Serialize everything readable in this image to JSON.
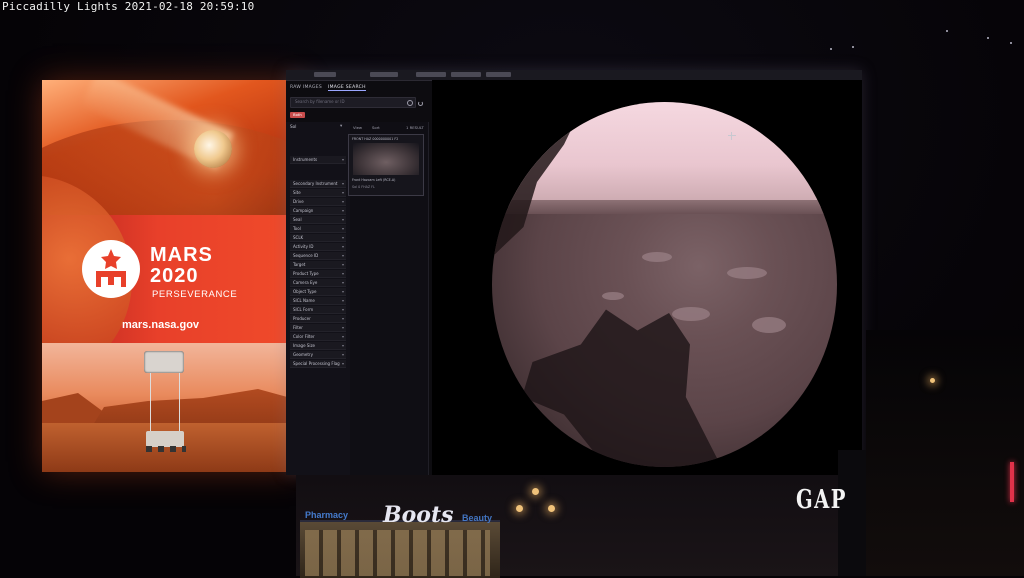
{
  "timestamp": "Piccadilly Lights 2021-02-18 20:59:10",
  "left_billboard": {
    "logo_line1": "MARS",
    "logo_line2": "2020",
    "logo_sub": "PERSEVERANCE",
    "url": "mars.nasa.gov"
  },
  "app": {
    "tabs": [
      "RAW IMAGES",
      "IMAGE SEARCH"
    ],
    "search_placeholder": "Search by filename or ID",
    "chip_label": "Both",
    "filter_title": "Sol",
    "filters": [
      "Instruments",
      "Secondary Instrument",
      "Site",
      "Drive",
      "Campaign",
      "Seal",
      "Tool",
      "SCLK",
      "Activity ID",
      "Sequence ID",
      "Target",
      "Product Type",
      "Camera Eye",
      "Object Type",
      "SICL Name",
      "SICL Form",
      "Producer",
      "Filter",
      "Color Filter",
      "Image Size",
      "Geometry",
      "Special Processing Flag"
    ],
    "view_label": "View",
    "sort_label": "Sort",
    "results_label": "1 RESULT",
    "thumbnail": {
      "title": "FRONT HAZ 0000000001 F2",
      "caption": "Front Hazcam Left (RCE-A)",
      "meta": "Sol 0   FHAZ   FL"
    }
  },
  "street": {
    "boots": "Boots",
    "pharmacy_left": "Pharmacy",
    "pharmacy_right": "Beauty",
    "gap": "GAP"
  },
  "colors": {
    "mars_red": "#e8402a",
    "screen_bg": "#0d0c10",
    "chip": "#c84c4c",
    "boots_blue": "#4a86e0"
  },
  "icons": [
    "search-icon",
    "refresh-icon",
    "crosshair-icon",
    "chevron-down-icon"
  ]
}
